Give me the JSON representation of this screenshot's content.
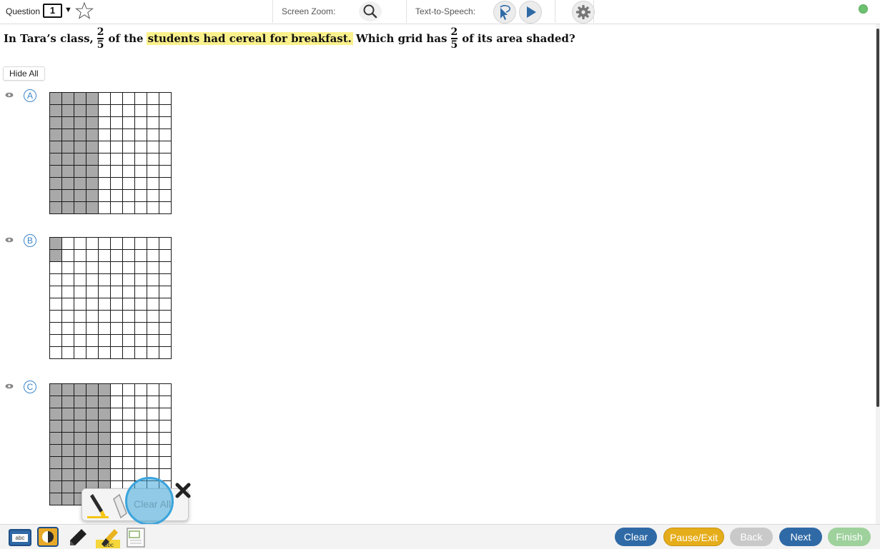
{
  "topbar": {
    "question_label": "Question",
    "question_number": "1",
    "zoom_label": "Screen Zoom:",
    "tts_label": "Text-to-Speech:"
  },
  "question": {
    "part1": "In Tara’s class,",
    "frac_num": "2",
    "frac_den": "5",
    "part2": "of the",
    "highlight": "students had cereal for breakfast.",
    "part3": "Which grid has",
    "part4": "of its area shaded?"
  },
  "hide_all_label": "Hide All",
  "options": [
    {
      "letter": "A",
      "shaded_rows": 10,
      "shaded_cols": 4
    },
    {
      "letter": "B",
      "shaded_rows": 2,
      "shaded_cols": 1
    },
    {
      "letter": "C",
      "shaded_rows": 10,
      "shaded_cols": 5
    }
  ],
  "palette": {
    "clear_all_label": "Clear All"
  },
  "bottombar": {
    "abc_label": "abc",
    "highlight_tool_label": "abc",
    "buttons": {
      "clear": "Clear",
      "pause_exit": "Pause/Exit",
      "back": "Back",
      "next": "Next",
      "finish": "Finish"
    }
  },
  "colors": {
    "accent_blue": "#2f6aa6",
    "pause_yellow": "#e6ad1b",
    "finish_green": "#9ed19c",
    "highlight": "#fbf18c",
    "grid_shade": "#a9a9a9"
  }
}
